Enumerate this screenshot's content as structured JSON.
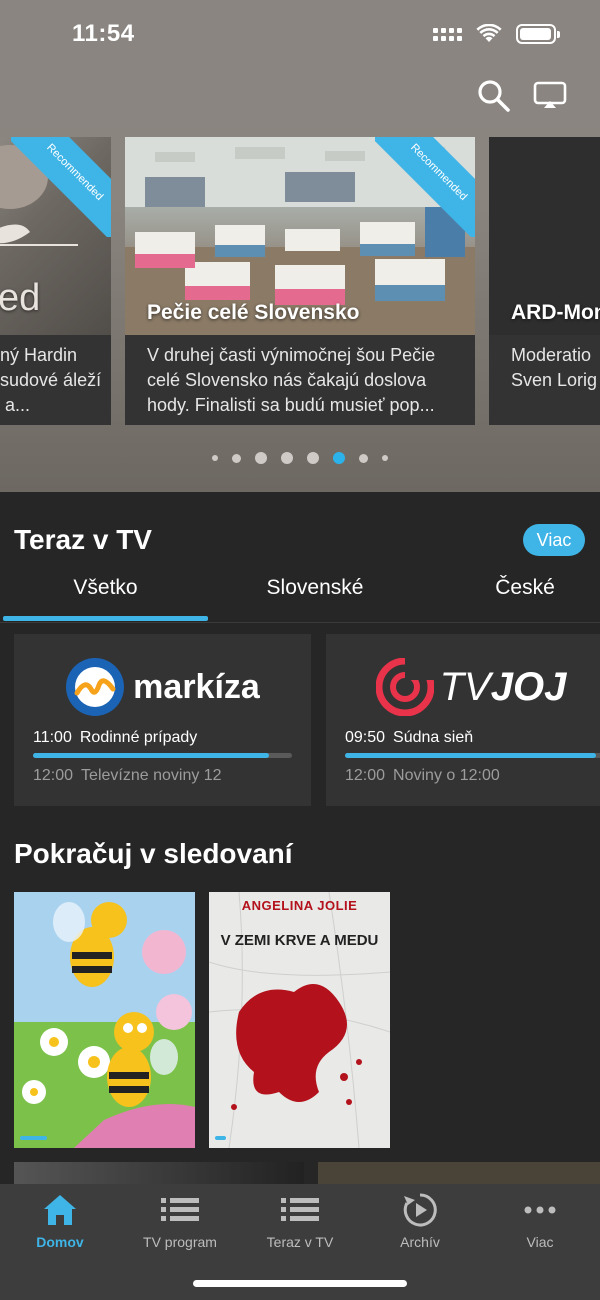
{
  "status_bar": {
    "time": "11:54"
  },
  "carousel": {
    "ribbon_label": "Recommended",
    "cards": [
      {
        "title": "ed",
        "desc": "nný Hardin osudové áleží a a..."
      },
      {
        "title": "Pečie celé Slovensko",
        "desc": "V druhej časti výnimočnej šou Pečie celé Slovensko nás čakajú doslova hody. Finalisti sa budú musieť pop..."
      },
      {
        "title": "ARD-Mon",
        "desc": "Moderatio Sven Lorig"
      }
    ],
    "page_count": 8,
    "active_page": 5
  },
  "now_on_tv": {
    "title": "Teraz v TV",
    "more_label": "Viac",
    "tabs": [
      "Všetko",
      "Slovenské",
      "České"
    ],
    "channels": [
      {
        "logo_text": "markíza",
        "now_time": "11:00",
        "now_title": "Rodinné prípady",
        "progress": 0.91,
        "next_time": "12:00",
        "next_title": "Televízne noviny 12"
      },
      {
        "logo_text_tv": "TV",
        "logo_text_joj": "JOJ",
        "now_time": "09:50",
        "now_title": "Súdna sieň",
        "progress": 0.97,
        "next_time": "12:00",
        "next_title": "Noviny o 12:00"
      }
    ]
  },
  "continue_watching": {
    "title": "Pokračuj v sledovaní",
    "posters": [
      {
        "kind": "animated-bees",
        "progress": 0.15
      },
      {
        "kind": "movie-poster",
        "headline": "ANGELINA JOLIE",
        "title": "V ZEMI KRVE A MEDU",
        "progress": 0.06
      }
    ]
  },
  "tabbar": {
    "items": [
      {
        "label": "Domov",
        "icon": "home-icon",
        "active": true
      },
      {
        "label": "TV program",
        "icon": "list-icon"
      },
      {
        "label": "Teraz v TV",
        "icon": "list-icon"
      },
      {
        "label": "Archív",
        "icon": "replay-icon"
      },
      {
        "label": "Viac",
        "icon": "more-dots-icon"
      }
    ]
  },
  "colors": {
    "accent": "#3fb4e6",
    "background": "#262626",
    "card": "#333333",
    "tabbar": "#3d3d3d"
  }
}
